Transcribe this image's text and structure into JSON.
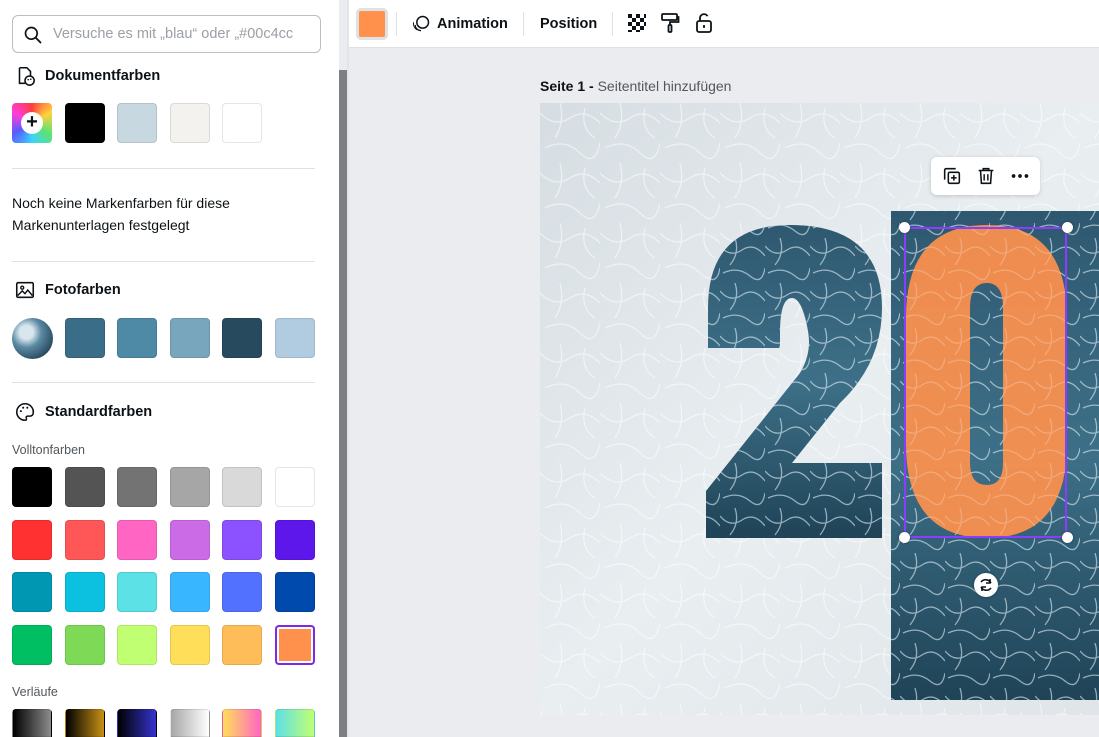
{
  "search": {
    "placeholder": "Versuche es mit „blau“ oder „#00c4cc"
  },
  "document_colors": {
    "title": "Dokumentfarben",
    "swatches": [
      "#000000",
      "#c8d8e0",
      "#f3f2ee",
      "#ffffff"
    ]
  },
  "brand": {
    "note": "Noch keine Markenfarben für diese Markenunterlagen festgelegt"
  },
  "photo_colors": {
    "title": "Fotofarben",
    "swatches": [
      "#3a6d87",
      "#4e8aa6",
      "#77a6bd",
      "#284a5e",
      "#b1cce0"
    ]
  },
  "standard_colors": {
    "title": "Standardfarben",
    "solid_label": "Volltonfarben",
    "gradient_label": "Verläufe",
    "selected": "#ff914d"
  },
  "toolbar": {
    "current_color": "#ff914d",
    "animation_label": "Animation",
    "position_label": "Position"
  },
  "canvas": {
    "page_label": "Seite 1 -",
    "page_subtitle": "Seitentitel hinzufügen",
    "digit_left": "2",
    "digit_right": "0",
    "accent_color": "#8b3dff",
    "orange": "#ff914d"
  }
}
